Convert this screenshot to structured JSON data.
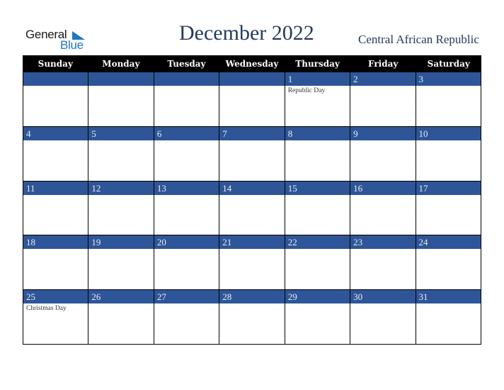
{
  "logo": {
    "word1": "General",
    "word2": "Blue"
  },
  "title": "December 2022",
  "country": "Central African Republic",
  "colors": {
    "header_bg": "#000000",
    "day_bar": "#2e5597",
    "title": "#253a5e",
    "logo_blue": "#1f78c1"
  },
  "weekdays": [
    "Sunday",
    "Monday",
    "Tuesday",
    "Wednesday",
    "Thursday",
    "Friday",
    "Saturday"
  ],
  "weeks": [
    [
      {
        "d": ""
      },
      {
        "d": ""
      },
      {
        "d": ""
      },
      {
        "d": ""
      },
      {
        "d": "1",
        "ev": "Republic Day"
      },
      {
        "d": "2"
      },
      {
        "d": "3"
      }
    ],
    [
      {
        "d": "4"
      },
      {
        "d": "5"
      },
      {
        "d": "6"
      },
      {
        "d": "7"
      },
      {
        "d": "8"
      },
      {
        "d": "9"
      },
      {
        "d": "10"
      }
    ],
    [
      {
        "d": "11"
      },
      {
        "d": "12"
      },
      {
        "d": "13"
      },
      {
        "d": "14"
      },
      {
        "d": "15"
      },
      {
        "d": "16"
      },
      {
        "d": "17"
      }
    ],
    [
      {
        "d": "18"
      },
      {
        "d": "19"
      },
      {
        "d": "20"
      },
      {
        "d": "21"
      },
      {
        "d": "22"
      },
      {
        "d": "23"
      },
      {
        "d": "24"
      }
    ],
    [
      {
        "d": "25",
        "ev": "Christmas Day"
      },
      {
        "d": "26"
      },
      {
        "d": "27"
      },
      {
        "d": "28"
      },
      {
        "d": "29"
      },
      {
        "d": "30"
      },
      {
        "d": "31"
      }
    ]
  ]
}
